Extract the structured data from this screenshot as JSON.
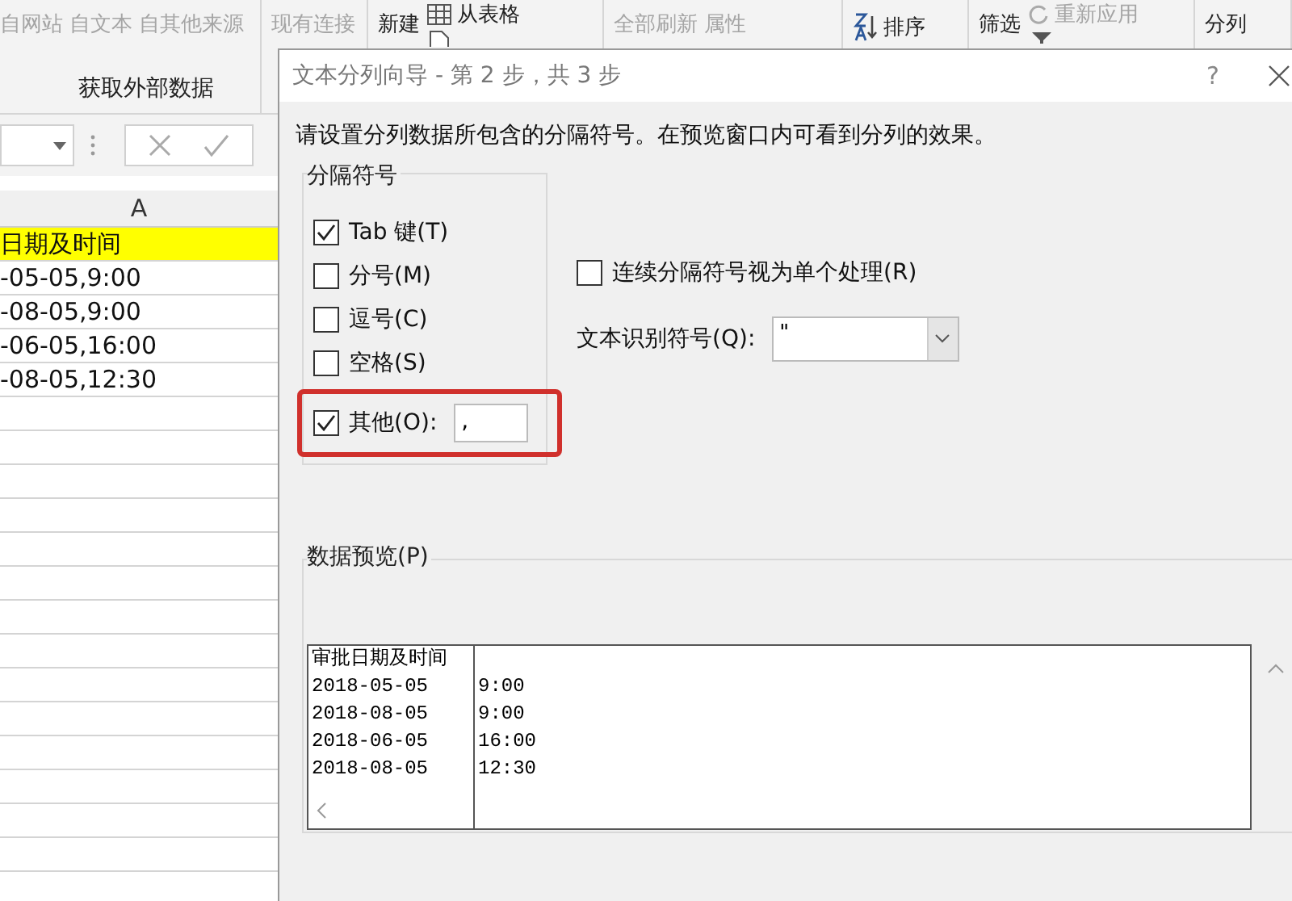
{
  "ribbon": {
    "groups": [
      {
        "label": "获取外部数据",
        "columns": [
          [
            {
              "label": "自网站",
              "disabled": true
            }
          ],
          [
            {
              "label": "自文本",
              "disabled": true
            }
          ],
          [
            {
              "label": "自其他来源",
              "disabled": true
            }
          ]
        ]
      },
      {
        "columns": [
          [
            {
              "label": "现有连接",
              "disabled": true
            }
          ]
        ]
      },
      {
        "columns": [
          [
            {
              "label": "新建",
              "disabled": false
            }
          ],
          [
            {
              "label": "从表格",
              "disabled": false
            }
          ]
        ]
      },
      {
        "columns": [
          [
            {
              "label": "全部刷新",
              "disabled": true
            }
          ],
          [
            {
              "label": "属性",
              "disabled": true
            }
          ]
        ]
      },
      {
        "columns": [
          [
            {
              "label": "排序",
              "disabled": false
            }
          ]
        ]
      },
      {
        "columns": [
          [
            {
              "label": "筛选",
              "disabled": false
            }
          ],
          [
            {
              "label": "重新应用",
              "disabled": true
            }
          ]
        ]
      },
      {
        "columns": [
          [
            {
              "label": "分列",
              "disabled": false
            }
          ]
        ]
      }
    ]
  },
  "sheet": {
    "column_header": "A",
    "rows": [
      {
        "text": "日期及时间",
        "highlighted": true
      },
      {
        "text": "-05-05,9:00",
        "highlighted": false
      },
      {
        "text": "-08-05,9:00",
        "highlighted": false
      },
      {
        "text": "-06-05,16:00",
        "highlighted": false
      },
      {
        "text": "-08-05,12:30",
        "highlighted": false
      }
    ]
  },
  "dialog": {
    "title": "文本分列向导 - 第 2 步，共 3 步",
    "help": "?",
    "instruction": "请设置分列数据所包含的分隔符号。在预览窗口内可看到分列的效果。",
    "delimiters": {
      "legend": "分隔符号",
      "items": [
        {
          "label": "Tab 键(T)",
          "checked": true
        },
        {
          "label": "分号(M)",
          "checked": false
        },
        {
          "label": "逗号(C)",
          "checked": false
        },
        {
          "label": "空格(S)",
          "checked": false
        },
        {
          "label": "其他(O):",
          "checked": true,
          "value": ",",
          "highlighted": true
        }
      ]
    },
    "consecutive": {
      "label": "连续分隔符号视为单个处理(R)",
      "checked": false
    },
    "qualifier": {
      "label": "文本识别符号(Q):",
      "value": "\""
    },
    "preview": {
      "legend": "数据预览(P)",
      "rows": [
        [
          "审批日期及时间",
          ""
        ],
        [
          "2018-05-05",
          "9:00"
        ],
        [
          "2018-08-05",
          "9:00"
        ],
        [
          "2018-06-05",
          "16:00"
        ],
        [
          "2018-08-05",
          "12:30"
        ]
      ]
    }
  }
}
